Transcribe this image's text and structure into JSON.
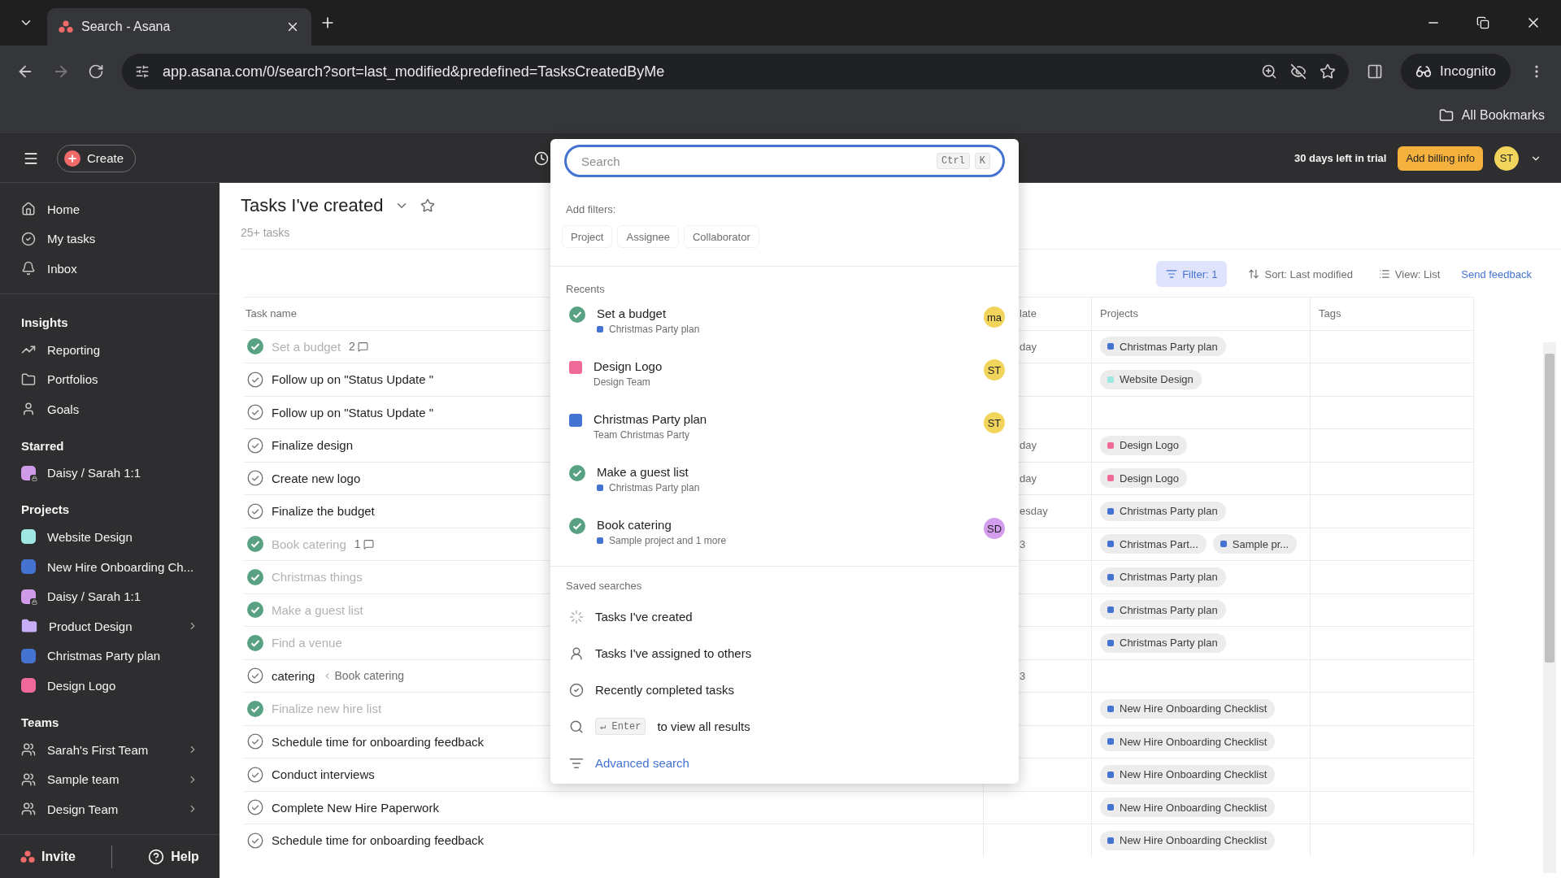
{
  "browser": {
    "tab_title": "Search - Asana",
    "url": "app.asana.com/0/search?sort=last_modified&predefined=TasksCreatedByMe",
    "profile": "Incognito",
    "bookmarks": "All Bookmarks"
  },
  "topbar": {
    "create": "Create",
    "trial": "30 days left in trial",
    "billing": "Add billing info",
    "avatar": "ST"
  },
  "sidebar": {
    "nav": [
      {
        "kind": "home",
        "label": "Home"
      },
      {
        "kind": "tasks",
        "label": "My tasks"
      },
      {
        "kind": "inbox",
        "label": "Inbox"
      }
    ],
    "sections": [
      {
        "title": "Insights",
        "items": [
          {
            "kind": "reporting",
            "label": "Reporting",
            "chevron": false
          },
          {
            "kind": "portfolios",
            "label": "Portfolios",
            "chevron": false
          },
          {
            "kind": "goals",
            "label": "Goals",
            "chevron": false
          }
        ]
      },
      {
        "title": "Starred",
        "items": [
          {
            "kind": "project",
            "color": "#cf9be8",
            "locked": true,
            "label": "Daisy / Sarah 1:1",
            "chevron": false
          }
        ]
      },
      {
        "title": "Projects",
        "items": [
          {
            "kind": "project",
            "color": "#9ee7e3",
            "locked": false,
            "label": "Website Design",
            "chevron": false
          },
          {
            "kind": "project",
            "color": "#4573d2",
            "locked": false,
            "label": "New Hire Onboarding Ch...",
            "chevron": false
          },
          {
            "kind": "project",
            "color": "#cf9be8",
            "locked": true,
            "label": "Daisy / Sarah 1:1",
            "chevron": false
          },
          {
            "kind": "folder",
            "color": "#c7aef7",
            "label": "Product Design",
            "chevron": true
          },
          {
            "kind": "project",
            "color": "#4573d2",
            "locked": false,
            "label": "Christmas Party plan",
            "chevron": false
          },
          {
            "kind": "project",
            "color": "#f06a99",
            "locked": false,
            "label": "Design Logo",
            "chevron": false
          }
        ]
      },
      {
        "title": "Teams",
        "items": [
          {
            "kind": "team",
            "label": "Sarah's First Team",
            "chevron": true
          },
          {
            "kind": "team",
            "label": "Sample team",
            "chevron": true
          },
          {
            "kind": "team",
            "label": "Design Team",
            "chevron": true
          }
        ]
      }
    ],
    "invite": "Invite",
    "help": "Help"
  },
  "main": {
    "title": "Tasks I've created",
    "count": "25+ tasks",
    "toolbar": {
      "filter": "Filter: 1",
      "sort": "Sort: Last modified",
      "view": "View: List",
      "feedback": "Send feedback"
    },
    "table": {
      "columns": {
        "task_name": "Task name",
        "column_3": "late",
        "projects": "Projects",
        "tags": "Tags"
      },
      "rows": [
        {
          "name": "Set a budget",
          "completed": true,
          "comments": "2",
          "column_3": "day",
          "projects": [
            {
              "name": "Christmas Party plan",
              "color": "#4573d2"
            }
          ]
        },
        {
          "name": "Follow up on \"Status Update \"",
          "completed": false,
          "projects": [
            {
              "name": "Website Design",
              "color": "#9ee7e3"
            }
          ]
        },
        {
          "name": "Follow up on \"Status Update \"",
          "completed": false,
          "projects": []
        },
        {
          "name": "Finalize design",
          "completed": false,
          "column_3": "day",
          "projects": [
            {
              "name": "Design Logo",
              "color": "#f06a99"
            }
          ]
        },
        {
          "name": "Create new logo",
          "completed": false,
          "column_3": "day",
          "projects": [
            {
              "name": "Design Logo",
              "color": "#f06a99"
            }
          ]
        },
        {
          "name": "Finalize the budget",
          "completed": false,
          "column_3": "esday",
          "projects": [
            {
              "name": "Christmas Party plan",
              "color": "#4573d2"
            }
          ]
        },
        {
          "name": "Book catering",
          "completed": true,
          "comments": "1",
          "column_3": "3",
          "projects": [
            {
              "name": "Christmas Part...",
              "color": "#4573d2"
            },
            {
              "name": "Sample pr...",
              "color": "#4573d2"
            }
          ]
        },
        {
          "name": "Christmas things",
          "completed": true,
          "projects": [
            {
              "name": "Christmas Party plan",
              "color": "#4573d2"
            }
          ]
        },
        {
          "name": "Make a guest list",
          "completed": true,
          "projects": [
            {
              "name": "Christmas Party plan",
              "color": "#4573d2"
            }
          ]
        },
        {
          "name": "Find a venue",
          "completed": true,
          "projects": [
            {
              "name": "Christmas Party plan",
              "color": "#4573d2"
            }
          ]
        },
        {
          "name": "catering",
          "completed": false,
          "parent": "Book catering",
          "column_3": "3",
          "projects": []
        },
        {
          "name": "Finalize new hire list",
          "completed": true,
          "projects": [
            {
              "name": "New Hire Onboarding Checklist",
              "color": "#4573d2"
            }
          ]
        },
        {
          "name": "Schedule time for onboarding feedback",
          "completed": false,
          "projects": [
            {
              "name": "New Hire Onboarding Checklist",
              "color": "#4573d2"
            }
          ]
        },
        {
          "name": "Conduct interviews",
          "completed": false,
          "projects": [
            {
              "name": "New Hire Onboarding Checklist",
              "color": "#4573d2"
            }
          ]
        },
        {
          "name": "Complete New Hire Paperwork",
          "completed": false,
          "projects": [
            {
              "name": "New Hire Onboarding Checklist",
              "color": "#4573d2"
            }
          ]
        },
        {
          "name": "Schedule time for onboarding feedback",
          "completed": false,
          "projects": [
            {
              "name": "New Hire Onboarding Checklist",
              "color": "#4573d2"
            }
          ]
        }
      ]
    }
  },
  "search_menu": {
    "placeholder": "Search",
    "shortcut": [
      "Ctrl",
      "K"
    ],
    "filters_label": "Add filters:",
    "filters": [
      "Project",
      "Assignee",
      "Collaborator"
    ],
    "recents_label": "Recents",
    "recents": [
      {
        "kind": "task",
        "title": "Set a budget",
        "subtitle": {
          "text": "Christmas Party plan",
          "color": "#4573d2"
        },
        "avatar": {
          "initials": "ma",
          "color": "#f1d45c"
        }
      },
      {
        "kind": "project",
        "title": "Design Logo",
        "color": "#f06a99",
        "subtitle": {
          "text": "Design Team"
        },
        "avatar": {
          "initials": "ST",
          "color": "#f1d45c"
        }
      },
      {
        "kind": "project",
        "title": "Christmas Party plan",
        "color": "#4573d2",
        "subtitle": {
          "text": "Team Christmas Party"
        },
        "avatar": {
          "initials": "ST",
          "color": "#f1d45c"
        }
      },
      {
        "kind": "task",
        "title": "Make a guest list",
        "subtitle": {
          "text": "Christmas Party plan",
          "color": "#4573d2"
        }
      },
      {
        "kind": "task",
        "title": "Book catering",
        "subtitle": {
          "text": "Sample project and 1 more",
          "color": "#4573d2"
        },
        "avatar": {
          "initials": "SD",
          "color": "#d39ced"
        }
      }
    ],
    "saved_label": "Saved searches",
    "saved": [
      {
        "kind": "created",
        "label": "Tasks I've created"
      },
      {
        "kind": "assigned",
        "label": "Tasks I've assigned to others"
      },
      {
        "kind": "completed",
        "label": "Recently completed tasks"
      }
    ],
    "enter_key": "↵ Enter",
    "enter_hint": "to view all results",
    "advanced": "Advanced search"
  }
}
